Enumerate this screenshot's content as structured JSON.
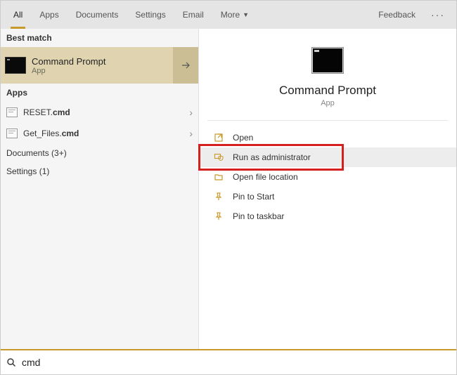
{
  "tabs": {
    "items": [
      {
        "label": "All",
        "active": true
      },
      {
        "label": "Apps"
      },
      {
        "label": "Documents"
      },
      {
        "label": "Settings"
      },
      {
        "label": "Email"
      },
      {
        "label": "More",
        "dropdown": true
      }
    ],
    "feedback": "Feedback"
  },
  "left": {
    "best_match_header": "Best match",
    "best_match": {
      "title": "Command Prompt",
      "subtitle": "App"
    },
    "apps_header": "Apps",
    "apps": [
      {
        "name": "RESET.",
        "ext": "cmd"
      },
      {
        "name": "Get_Files.",
        "ext": "cmd"
      }
    ],
    "documents_header": "Documents (3+)",
    "settings_header": "Settings (1)"
  },
  "right": {
    "title": "Command Prompt",
    "subtitle": "App",
    "actions": [
      {
        "icon": "open",
        "label": "Open"
      },
      {
        "icon": "admin",
        "label": "Run as administrator",
        "highlighted": true
      },
      {
        "icon": "folder",
        "label": "Open file location"
      },
      {
        "icon": "pin-start",
        "label": "Pin to Start"
      },
      {
        "icon": "pin-taskbar",
        "label": "Pin to taskbar"
      }
    ]
  },
  "search": {
    "value": "cmd"
  }
}
